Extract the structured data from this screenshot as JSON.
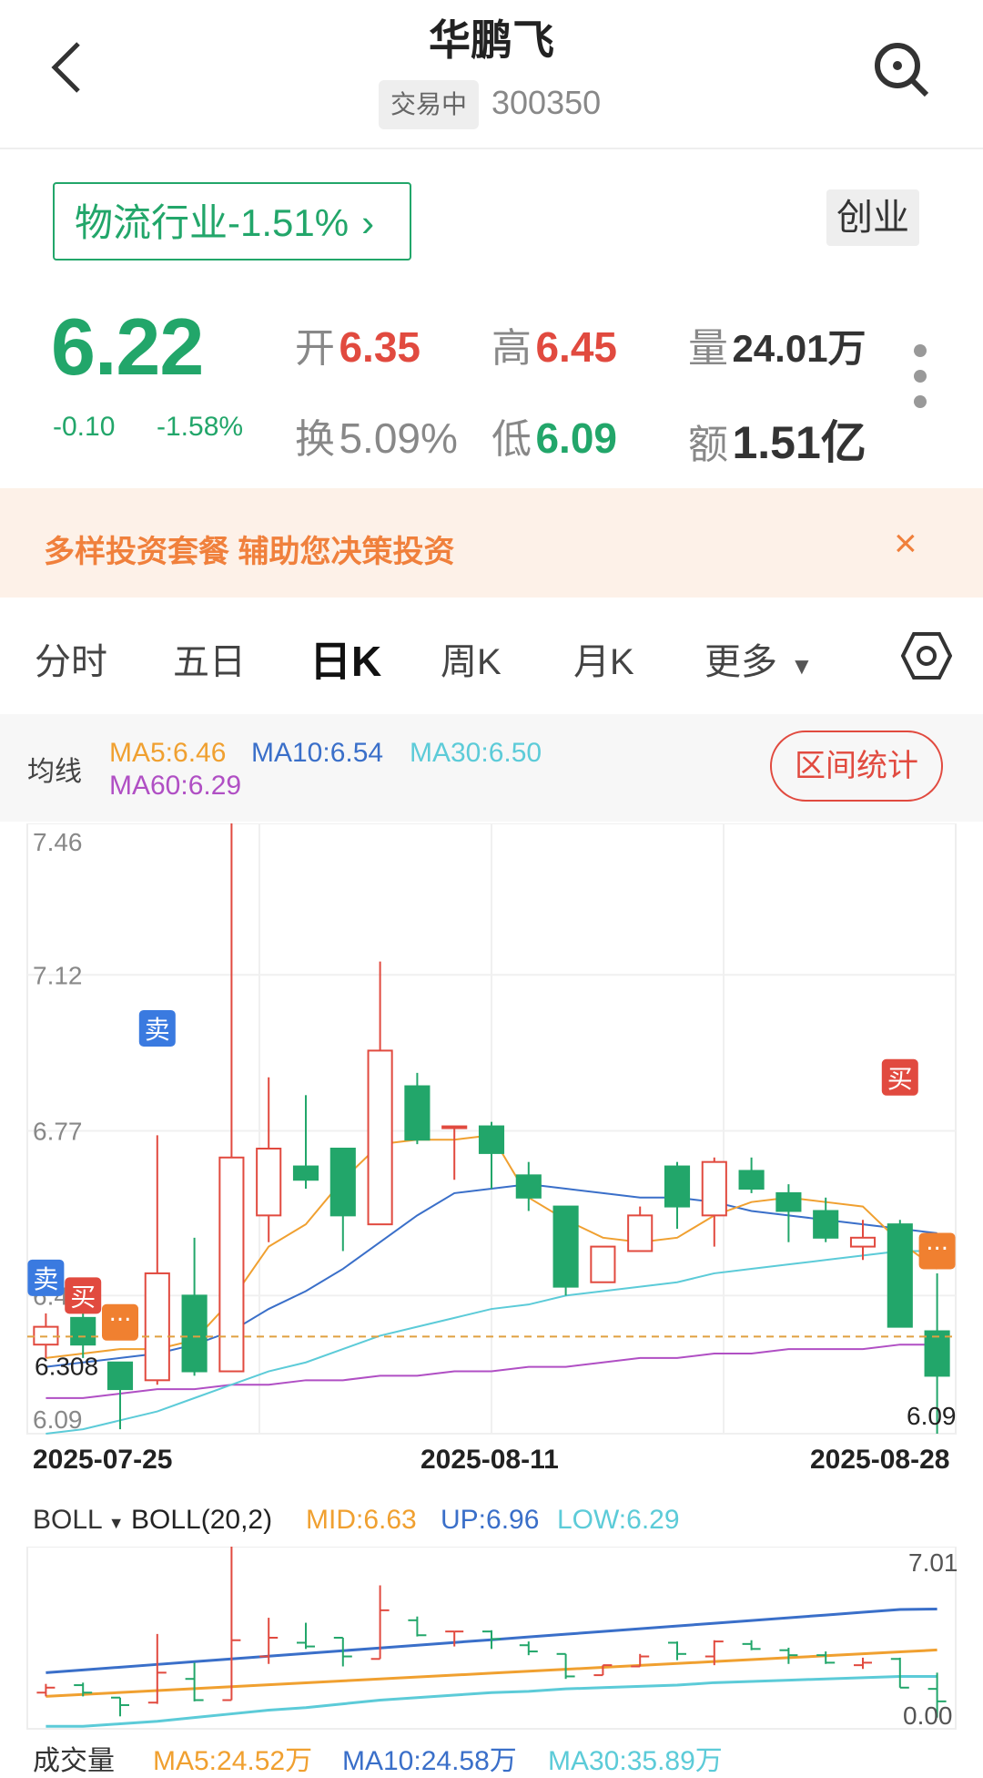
{
  "header": {
    "title": "华鹏飞",
    "status_badge": "交易中",
    "code": "300350"
  },
  "industry": {
    "label": "物流行业",
    "change": "-1.51%",
    "board": "创业"
  },
  "quote": {
    "price": "6.22",
    "change": "-0.10",
    "change_pct": "-1.58%",
    "open_label": "开",
    "open": "6.35",
    "high_label": "高",
    "high": "6.45",
    "volume_label": "量",
    "volume": "24.01万",
    "turnover_label": "换",
    "turnover": "5.09%",
    "low_label": "低",
    "low": "6.09",
    "amount_label": "额",
    "amount": "1.51亿"
  },
  "banner": {
    "text": "多样投资套餐 辅助您决策投资",
    "close": "×"
  },
  "tabs": [
    {
      "label": "分时"
    },
    {
      "label": "五日"
    },
    {
      "label": "日K"
    },
    {
      "label": "周K"
    },
    {
      "label": "月K"
    },
    {
      "label": "更多"
    }
  ],
  "ma_bar": {
    "label": "均线",
    "ma5": "MA5:6.46",
    "ma10": "MA10:6.54",
    "ma30": "MA30:6.50",
    "ma60": "MA60:6.29",
    "range_button": "区间统计"
  },
  "colors": {
    "up": "#e14a3f",
    "down": "#22a66a",
    "ma5": "#f0a030",
    "ma10": "#3a6fc9",
    "ma30": "#5ccbd8",
    "ma60": "#b04fc4"
  },
  "chart_data": {
    "type": "candlestick",
    "ylim": [
      6.09,
      7.46
    ],
    "y_ticks": [
      "7.46",
      "7.12",
      "6.77",
      "6.4",
      "6.09"
    ],
    "dates": [
      "2025-07-25",
      "2025-08-11",
      "2025-08-28"
    ],
    "current_price_label": "6.308",
    "low_label": "6.09",
    "markers": [
      "卖",
      "卖",
      "买",
      "买"
    ],
    "candles": [
      {
        "o": 6.29,
        "c": 6.33,
        "h": 6.36,
        "l": 6.26
      },
      {
        "o": 6.35,
        "c": 6.29,
        "h": 6.37,
        "l": 6.26
      },
      {
        "o": 6.25,
        "c": 6.19,
        "h": 6.25,
        "l": 6.1
      },
      {
        "o": 6.21,
        "c": 6.45,
        "h": 6.76,
        "l": 6.2
      },
      {
        "o": 6.4,
        "c": 6.23,
        "h": 6.53,
        "l": 6.22
      },
      {
        "o": 6.23,
        "c": 6.71,
        "h": 7.46,
        "l": 6.23
      },
      {
        "o": 6.58,
        "c": 6.73,
        "h": 6.89,
        "l": 6.52
      },
      {
        "o": 6.69,
        "c": 6.66,
        "h": 6.85,
        "l": 6.64
      },
      {
        "o": 6.73,
        "c": 6.58,
        "h": 6.73,
        "l": 6.5
      },
      {
        "o": 6.56,
        "c": 6.95,
        "h": 7.15,
        "l": 6.56
      },
      {
        "o": 6.87,
        "c": 6.75,
        "h": 6.9,
        "l": 6.74
      },
      {
        "o": 6.78,
        "c": 6.78,
        "h": 6.78,
        "l": 6.66
      },
      {
        "o": 6.78,
        "c": 6.72,
        "h": 6.79,
        "l": 6.64
      },
      {
        "o": 6.67,
        "c": 6.62,
        "h": 6.7,
        "l": 6.59
      },
      {
        "o": 6.6,
        "c": 6.42,
        "h": 6.6,
        "l": 6.4
      },
      {
        "o": 6.43,
        "c": 6.51,
        "h": 6.51,
        "l": 6.43
      },
      {
        "o": 6.5,
        "c": 6.58,
        "h": 6.6,
        "l": 6.5
      },
      {
        "o": 6.69,
        "c": 6.6,
        "h": 6.7,
        "l": 6.55
      },
      {
        "o": 6.58,
        "c": 6.7,
        "h": 6.71,
        "l": 6.51
      },
      {
        "o": 6.68,
        "c": 6.64,
        "h": 6.71,
        "l": 6.63
      },
      {
        "o": 6.63,
        "c": 6.59,
        "h": 6.65,
        "l": 6.52
      },
      {
        "o": 6.59,
        "c": 6.53,
        "h": 6.62,
        "l": 6.52
      },
      {
        "o": 6.51,
        "c": 6.53,
        "h": 6.57,
        "l": 6.48
      },
      {
        "o": 6.56,
        "c": 6.33,
        "h": 6.57,
        "l": 6.33
      },
      {
        "o": 6.32,
        "c": 6.22,
        "h": 6.45,
        "l": 6.09
      }
    ],
    "ma5": [
      6.26,
      6.27,
      6.28,
      6.28,
      6.3,
      6.39,
      6.51,
      6.56,
      6.66,
      6.74,
      6.75,
      6.75,
      6.76,
      6.62,
      6.57,
      6.53,
      6.52,
      6.53,
      6.58,
      6.61,
      6.62,
      6.61,
      6.6,
      6.52,
      6.46
    ],
    "ma10": [
      6.24,
      6.25,
      6.26,
      6.27,
      6.29,
      6.32,
      6.37,
      6.41,
      6.46,
      6.52,
      6.58,
      6.63,
      6.64,
      6.65,
      6.64,
      6.63,
      6.62,
      6.62,
      6.61,
      6.59,
      6.58,
      6.57,
      6.56,
      6.55,
      6.54
    ],
    "ma30": [
      6.09,
      6.1,
      6.12,
      6.14,
      6.17,
      6.2,
      6.23,
      6.25,
      6.28,
      6.31,
      6.33,
      6.35,
      6.37,
      6.38,
      6.4,
      6.41,
      6.42,
      6.43,
      6.45,
      6.46,
      6.47,
      6.48,
      6.49,
      6.5,
      6.5
    ],
    "ma60": [
      6.17,
      6.17,
      6.18,
      6.19,
      6.19,
      6.2,
      6.2,
      6.21,
      6.21,
      6.22,
      6.22,
      6.23,
      6.23,
      6.24,
      6.24,
      6.25,
      6.26,
      6.26,
      6.27,
      6.27,
      6.28,
      6.28,
      6.28,
      6.29,
      6.29
    ]
  },
  "boll": {
    "selector": "BOLL",
    "name": "BOLL(20,2)",
    "mid": "MID:6.63",
    "up": "UP:6.96",
    "low": "LOW:6.29",
    "top_label": "7.01",
    "bottom_label": "0.00"
  },
  "volume": {
    "label": "成交量",
    "ma5": "MA5:24.52万",
    "ma10": "MA10:24.58万",
    "ma30": "MA30:35.89万"
  }
}
